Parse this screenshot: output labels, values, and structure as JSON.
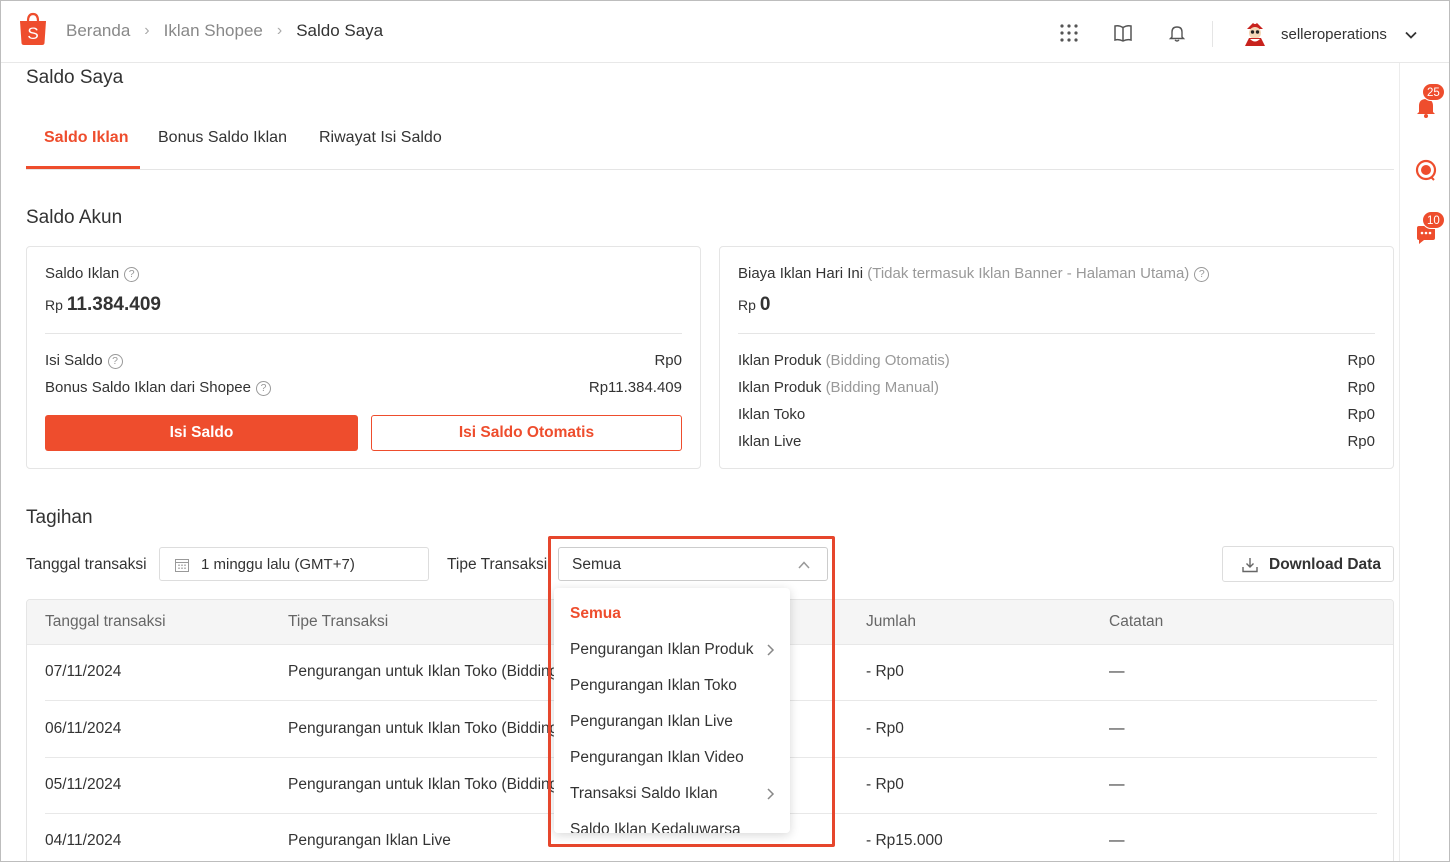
{
  "header": {
    "breadcrumb": [
      "Beranda",
      "Iklan Shopee",
      "Saldo Saya"
    ],
    "icons": [
      "apps-grid-icon",
      "book-icon",
      "bell-icon"
    ],
    "username": "selleroperations"
  },
  "rail": {
    "notifications_badge": "25",
    "chat_badge": "10"
  },
  "page": {
    "title": "Saldo Saya",
    "tabs": [
      "Saldo Iklan",
      "Bonus Saldo Iklan",
      "Riwayat Isi Saldo"
    ],
    "active_tab": "Saldo Iklan"
  },
  "saldo_akun": {
    "title": "Saldo Akun",
    "left_card": {
      "label": "Saldo Iklan",
      "currency": "Rp",
      "amount": "11.384.409",
      "rows": [
        {
          "label": "Isi Saldo",
          "value": "Rp0"
        },
        {
          "label": "Bonus Saldo Iklan dari Shopee",
          "value": "Rp11.384.409"
        }
      ],
      "btn_topup": "Isi Saldo",
      "btn_auto_topup": "Isi Saldo Otomatis"
    },
    "right_card": {
      "label": "Biaya Iklan Hari Ini",
      "note": "(Tidak termasuk Iklan Banner - Halaman Utama)",
      "currency": "Rp",
      "amount": "0",
      "rows": [
        {
          "label": "Iklan Produk",
          "sub": "(Bidding Otomatis)",
          "value": "Rp0"
        },
        {
          "label": "Iklan Produk",
          "sub": "(Bidding Manual)",
          "value": "Rp0"
        },
        {
          "label": "Iklan Toko",
          "sub": "",
          "value": "Rp0"
        },
        {
          "label": "Iklan Live",
          "sub": "",
          "value": "Rp0"
        }
      ]
    }
  },
  "tagihan": {
    "title": "Tagihan",
    "date_label": "Tanggal transaksi",
    "date_value": "1 minggu lalu (GMT+7)",
    "type_label": "Tipe Transaksi",
    "type_value": "Semua",
    "download_label": "Download Data",
    "columns": [
      "Tanggal transaksi",
      "Tipe Transaksi",
      "Jumlah",
      "Catatan"
    ],
    "rows": [
      {
        "date": "07/11/2024",
        "type": "Pengurangan untuk Iklan Toko (Bidding",
        "amount": "- Rp0",
        "note": "—"
      },
      {
        "date": "06/11/2024",
        "type": "Pengurangan untuk Iklan Toko (Bidding",
        "amount": "- Rp0",
        "note": "—"
      },
      {
        "date": "05/11/2024",
        "type": "Pengurangan untuk Iklan Toko (Bidding",
        "amount": "- Rp0",
        "note": "—"
      },
      {
        "date": "04/11/2024",
        "type": "Pengurangan Iklan Live",
        "amount": "- Rp15.000",
        "note": "—"
      }
    ]
  },
  "dropdown": {
    "options": [
      {
        "label": "Semua",
        "selected": true,
        "submenu": false
      },
      {
        "label": "Pengurangan Iklan Produk",
        "selected": false,
        "submenu": true
      },
      {
        "label": "Pengurangan Iklan Toko",
        "selected": false,
        "submenu": false
      },
      {
        "label": "Pengurangan Iklan Live",
        "selected": false,
        "submenu": false
      },
      {
        "label": "Pengurangan Iklan Video",
        "selected": false,
        "submenu": false
      },
      {
        "label": "Transaksi Saldo Iklan",
        "selected": false,
        "submenu": true
      },
      {
        "label": "Saldo Iklan Kedaluwarsa",
        "selected": false,
        "submenu": false
      }
    ]
  },
  "colors": {
    "brand": "#ee4d2d",
    "highlight_box": "#e6462c"
  }
}
